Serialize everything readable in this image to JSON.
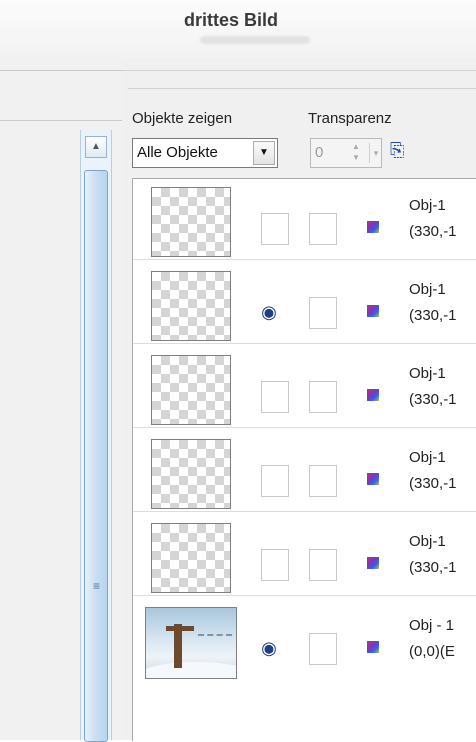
{
  "window": {
    "title": "drittes Bild"
  },
  "toolbar": {
    "show_objects_label": "Objekte zeigen",
    "transparency_label": "Transparenz",
    "show_objects_value": "Alle Objekte",
    "transparency_value": "0"
  },
  "icons": {
    "new_object": "new-object-icon",
    "visible": "eye-icon",
    "color": "color-cube-icon"
  },
  "rows": [
    {
      "name": "Obj-1",
      "coords": "(330,-1",
      "visible": false,
      "thumb": "transparent"
    },
    {
      "name": "Obj-1",
      "coords": "(330,-1",
      "visible": true,
      "thumb": "transparent"
    },
    {
      "name": "Obj-1",
      "coords": "(330,-1",
      "visible": false,
      "thumb": "transparent"
    },
    {
      "name": "Obj-1",
      "coords": "(330,-1",
      "visible": false,
      "thumb": "transparent"
    },
    {
      "name": "Obj-1",
      "coords": "(330,-1",
      "visible": false,
      "thumb": "transparent"
    },
    {
      "name": "Obj - 1",
      "coords": "(0,0)(E",
      "visible": true,
      "thumb": "scene"
    }
  ]
}
